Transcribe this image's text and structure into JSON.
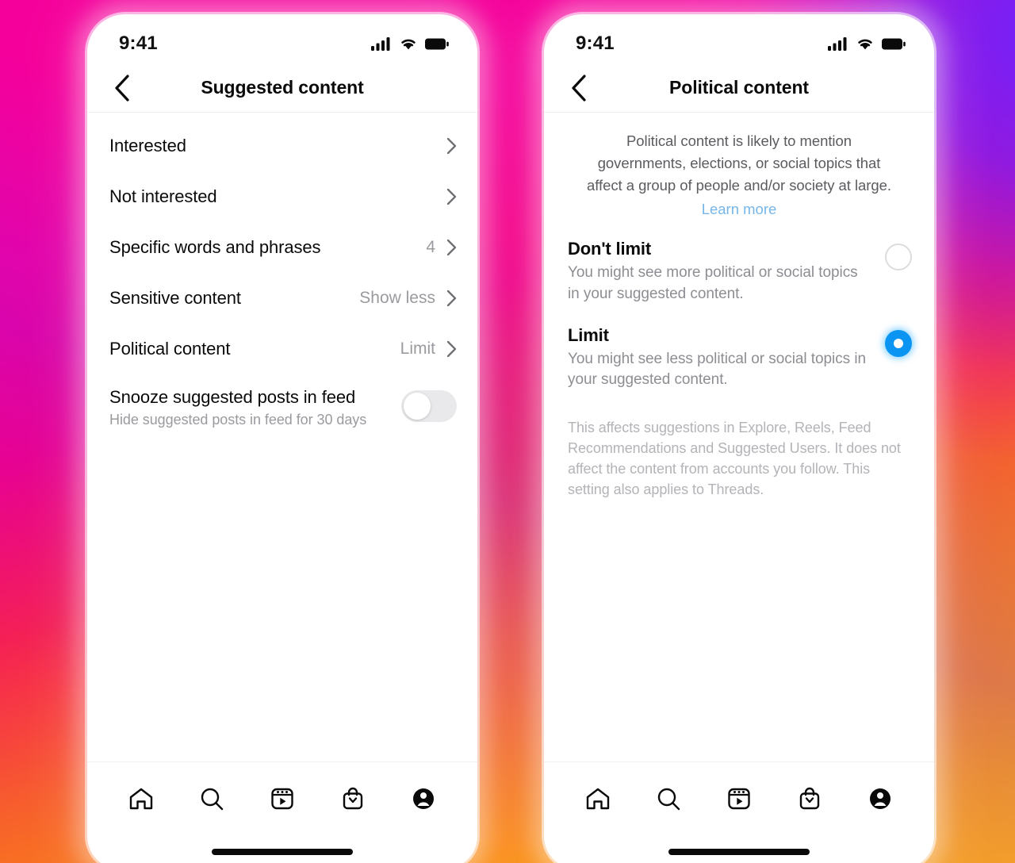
{
  "background": {
    "gradient_colors": [
      "#f5009b",
      "#f5214f",
      "#f98d13",
      "#fdbe0a",
      "#6c24ff",
      "#a610e8"
    ]
  },
  "accent": {
    "radio_selected": "#0a95f3",
    "link": "#76b6e8",
    "muted_text": "#9a9a9f"
  },
  "phone_left": {
    "status": {
      "time": "9:41",
      "icons": [
        "cellular-signal-icon",
        "wifi-icon",
        "battery-icon"
      ]
    },
    "header": {
      "back": "back-chevron-icon",
      "title": "Suggested content"
    },
    "rows": [
      {
        "label": "Interested",
        "value": ""
      },
      {
        "label": "Not interested",
        "value": ""
      },
      {
        "label": "Specific words and phrases",
        "value": "4"
      },
      {
        "label": "Sensitive content",
        "value": "Show less"
      },
      {
        "label": "Political content",
        "value": "Limit"
      }
    ],
    "snooze": {
      "title": "Snooze suggested posts in feed",
      "subtitle": "Hide suggested posts in feed for 30 days",
      "enabled": false
    },
    "tabs": [
      "home-icon",
      "search-icon",
      "reels-icon",
      "shop-icon",
      "profile-icon"
    ]
  },
  "phone_right": {
    "status": {
      "time": "9:41",
      "icons": [
        "cellular-signal-icon",
        "wifi-icon",
        "battery-icon"
      ]
    },
    "header": {
      "back": "back-chevron-icon",
      "title": "Political content"
    },
    "intro": {
      "text": "Political content is likely to mention governments, elections, or social topics that affect a group of people and/or society at large.",
      "link": "Learn more"
    },
    "options": [
      {
        "title": "Don't limit",
        "description": "You might see more political or social topics in your suggested content.",
        "selected": false
      },
      {
        "title": "Limit",
        "description": "You might see less political or social topics in your suggested content.",
        "selected": true
      }
    ],
    "footnote": "This affects suggestions in Explore, Reels, Feed Recommendations and Suggested Users. It does not affect the content from accounts you follow. This setting also applies to Threads.",
    "tabs": [
      "home-icon",
      "search-icon",
      "reels-icon",
      "shop-icon",
      "profile-icon"
    ]
  }
}
